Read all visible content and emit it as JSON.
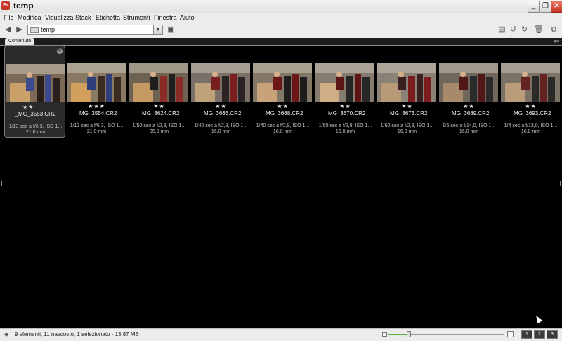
{
  "window": {
    "title": "temp",
    "app_icon": "Br"
  },
  "menu": [
    "File",
    "Modifica",
    "Visualizza",
    "Stack",
    "Etichetta",
    "Strumenti",
    "Finestra",
    "Aiuto"
  ],
  "toolbar": {
    "path": "temp"
  },
  "panel": {
    "tab_label": "Contenuto",
    "panel_menu": "▾≡"
  },
  "thumbnails": [
    {
      "name": "_MG_3553.CR2",
      "rating": "★★",
      "rating_rest": "· · ·",
      "meta1": "1/13 sec a f/6,3, ISO 1...",
      "meta2": "21,0 mm",
      "selected": true
    },
    {
      "name": "_MG_3554.CR2",
      "rating": "★★★",
      "rating_rest": "",
      "meta1": "1/13 sec a f/6,3, ISO 1...",
      "meta2": "21,0 mm",
      "selected": false
    },
    {
      "name": "_MG_3624.CR2",
      "rating": "★★",
      "rating_rest": "",
      "meta1": "1/50 sec a f/2,8, ISO 1...",
      "meta2": "35,0 mm",
      "selected": false
    },
    {
      "name": "_MG_3666.CR2",
      "rating": "★★",
      "rating_rest": "",
      "meta1": "1/40 sec a f/2,8, ISO 1...",
      "meta2": "16,0 mm",
      "selected": false
    },
    {
      "name": "_MG_3668.CR2",
      "rating": "★★",
      "rating_rest": "",
      "meta1": "1/40 sec a f/2,8, ISO 1...",
      "meta2": "16,0 mm",
      "selected": false
    },
    {
      "name": "_MG_3670.CR2",
      "rating": "★★",
      "rating_rest": "",
      "meta1": "1/60 sec a f/2,8, ISO 1...",
      "meta2": "16,0 mm",
      "selected": false
    },
    {
      "name": "_MG_3673.CR2",
      "rating": "★★",
      "rating_rest": "",
      "meta1": "1/60 sec a f/2,8, ISO 1...",
      "meta2": "16,0 mm",
      "selected": false
    },
    {
      "name": "_MG_3689.CR2",
      "rating": "★★",
      "rating_rest": "",
      "meta1": "1/5 sec a f/14,0, ISO 1...",
      "meta2": "16,0 mm",
      "selected": false
    },
    {
      "name": "_MG_3693.CR2",
      "rating": "★★",
      "rating_rest": "",
      "meta1": "1/4 sec a f/13,0, ISO 1...",
      "meta2": "16,0 mm",
      "selected": false
    }
  ],
  "status": {
    "text": "9 elementi, 11 nascosto, 1 selezionato - 13.87 MB",
    "zoom_fraction": 0.18,
    "view_buttons": [
      "1",
      "2",
      "3"
    ]
  },
  "colors": {
    "content_bg": "#000000",
    "chrome_bg": "#ececec",
    "slider_fill": "#5cb037",
    "close_button": "#c8341f"
  }
}
